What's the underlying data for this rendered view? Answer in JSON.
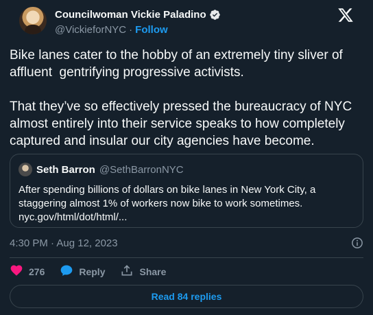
{
  "author": {
    "display_name": "Councilwoman Vickie Paladino",
    "handle": "@VickieforNYC",
    "separator": "·",
    "follow_label": "Follow"
  },
  "tweet": {
    "text": "Bike lanes cater to the hobby of an extremely tiny sliver of\naffluent  gentrifying progressive activists.\n\nThat they’ve so effectively pressed the bureaucracy of NYC\nalmost entirely into their service speaks to how completely\ncaptured and insular our city agencies have become."
  },
  "quote": {
    "name": "Seth Barron",
    "handle": "@SethBarronNYC",
    "text": "After spending billions of dollars on bike lanes in New York City, a staggering almost 1% of workers now bike to work sometimes.",
    "link": "nyc.gov/html/dot/html/..."
  },
  "meta": {
    "timestamp": "4:30 PM · Aug 12, 2023"
  },
  "actions": {
    "like_count": "276",
    "reply_label": "Reply",
    "share_label": "Share"
  },
  "read_replies_label": "Read 84 replies",
  "colors": {
    "background": "#15202b",
    "accent": "#1d9bf0",
    "like": "#f91880",
    "muted": "#8b98a5",
    "border": "#38444d"
  },
  "icons": [
    "verified-icon",
    "x-logo-icon",
    "info-icon",
    "heart-icon",
    "reply-bubble-icon",
    "share-icon"
  ]
}
